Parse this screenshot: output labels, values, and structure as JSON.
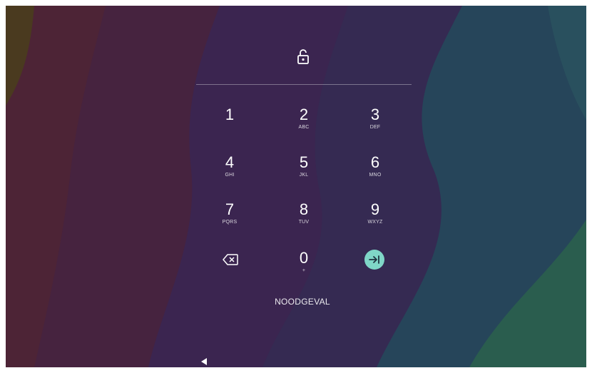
{
  "keypad": {
    "keys": [
      {
        "digit": "1",
        "letters": ""
      },
      {
        "digit": "2",
        "letters": "ABC"
      },
      {
        "digit": "3",
        "letters": "DEF"
      },
      {
        "digit": "4",
        "letters": "GHI"
      },
      {
        "digit": "5",
        "letters": "JKL"
      },
      {
        "digit": "6",
        "letters": "MNO"
      },
      {
        "digit": "7",
        "letters": "PQRS"
      },
      {
        "digit": "8",
        "letters": "TUV"
      },
      {
        "digit": "9",
        "letters": "WXYZ"
      },
      {
        "digit": "0",
        "letters": "+"
      }
    ],
    "backspace_icon": "backspace-icon",
    "enter_icon": "arrow-to-end-icon",
    "enter_color": "#7fd6c7"
  },
  "lock_icon": "lock-icon",
  "emergency_label": "NOODGEVAL",
  "nav": {
    "back_icon": "triangle-back-icon"
  }
}
